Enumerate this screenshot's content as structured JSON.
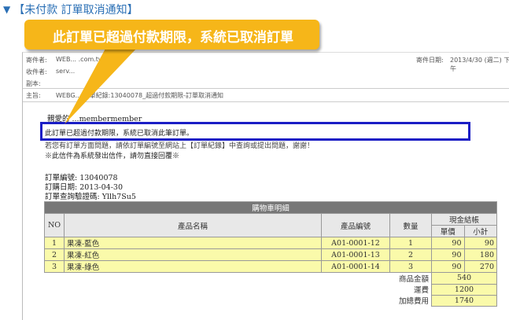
{
  "heading": {
    "icon": "triangle-down-icon",
    "text": "【未付款 訂單取消通知】"
  },
  "callout": {
    "text": "此訂單已超過付款期限，系統已取消訂單"
  },
  "email_header": {
    "from_label": "寄件者:",
    "from_value": "WEB...  .com.tw >",
    "to_label": "收件者:",
    "to_value": "serv...",
    "cc_label": "副本:",
    "subject_label": "主旨:",
    "subject_value": "WEBG...   訂單紀錄:13040078_超過付款期限-訂單取消通知",
    "date_label": "寄件日期:",
    "date_value": "2013/4/30 (週二) 下午"
  },
  "body": {
    "greeting": "親愛的 ...membermember",
    "line1": "此訂單已超過付款期限，系統已取消此筆訂單。",
    "line2": "若您有訂單方面問題，請依訂單編號至網站上【訂單紀錄】中查詢或提出問題，謝謝！",
    "line3": "※此信件為系統發出信件，請勿直接回覆※",
    "order_no": "訂單編號: 13040078",
    "order_date": "訂購日期: 2013-04-30",
    "verify": "訂單查詢驗證碼: Yllh7Su5"
  },
  "cart": {
    "title": "購物車明細",
    "headers": {
      "no": "NO",
      "name": "產品名稱",
      "code": "產品編號",
      "qty": "數量",
      "pay": "現金結帳",
      "price": "單價",
      "subtotal": "小計"
    },
    "rows": [
      {
        "no": "1",
        "name": "果凍-藍色",
        "code": "A01-0001-12",
        "qty": "1",
        "price": "90",
        "subtotal": "90"
      },
      {
        "no": "2",
        "name": "果凍-紅色",
        "code": "A01-0001-13",
        "qty": "2",
        "price": "90",
        "subtotal": "180"
      },
      {
        "no": "3",
        "name": "果凍-綠色",
        "code": "A01-0001-14",
        "qty": "3",
        "price": "90",
        "subtotal": "270"
      }
    ],
    "summary": [
      {
        "label": "商品金額",
        "value": "540"
      },
      {
        "label": "運費",
        "value": "1200"
      },
      {
        "label": "加總費用",
        "value": "1740"
      }
    ]
  },
  "colors": {
    "heading": "#2a6fb5",
    "callout": "#f6b619",
    "highlight_border": "#1b1ec5",
    "table_yellow": "#fafaaa"
  }
}
